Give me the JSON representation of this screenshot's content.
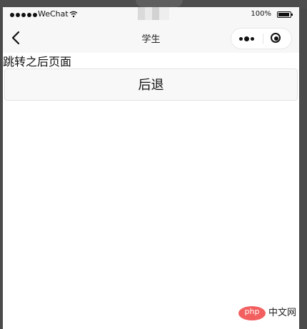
{
  "status": {
    "carrier": "WeChat",
    "battery": "100%"
  },
  "nav": {
    "title": "学生"
  },
  "page": {
    "message": "跳转之后页面",
    "back_button": "后退"
  },
  "watermark": {
    "logo": "php",
    "text": "中文网"
  },
  "colors": {
    "frame": "#4a4a4a",
    "background": "#ffffff",
    "nav": "#f7f7f7",
    "button": "#f8f8f8",
    "watermark_logo": "#f35f5f"
  },
  "icons": {
    "back": "chevron-left-icon",
    "more": "more-dots-icon",
    "close": "target-circle-icon"
  }
}
